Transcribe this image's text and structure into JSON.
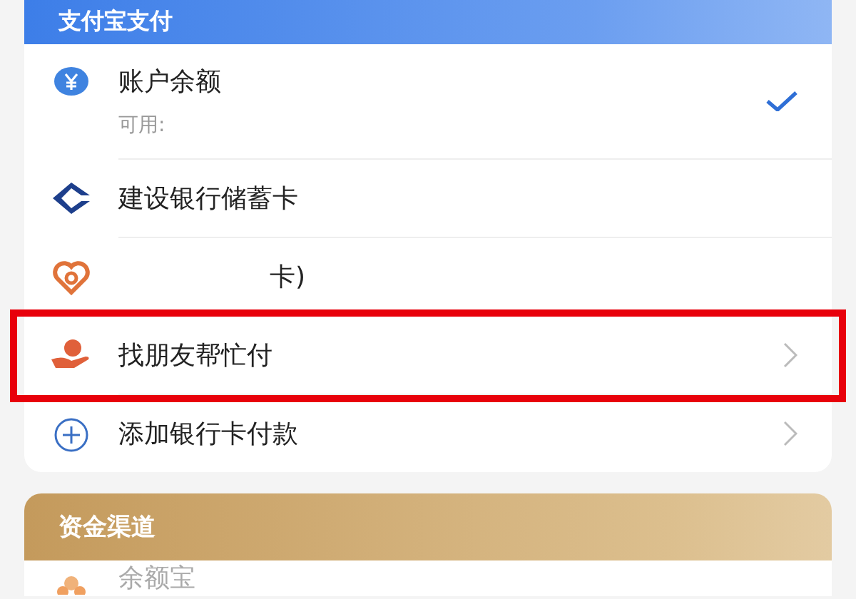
{
  "payment_section": {
    "title": "支付宝支付",
    "items": [
      {
        "kind": "balance",
        "label": "账户余额",
        "sublabel": "可用:",
        "selected": true,
        "arrow": false,
        "highlighted": false
      },
      {
        "kind": "ccb",
        "label": "建设银行储蓄卡",
        "selected": false,
        "arrow": false,
        "highlighted": false
      },
      {
        "kind": "union",
        "label": "卡)",
        "redacted": true,
        "selected": false,
        "arrow": false,
        "highlighted": false
      },
      {
        "kind": "friend",
        "label": "找朋友帮忙付",
        "selected": false,
        "arrow": true,
        "highlighted": true
      },
      {
        "kind": "add",
        "label": "添加银行卡付款",
        "selected": false,
        "arrow": true,
        "highlighted": false
      }
    ]
  },
  "fund_section": {
    "title": "资金渠道",
    "items": [
      {
        "kind": "yuebao",
        "label": "余额宝"
      }
    ]
  }
}
